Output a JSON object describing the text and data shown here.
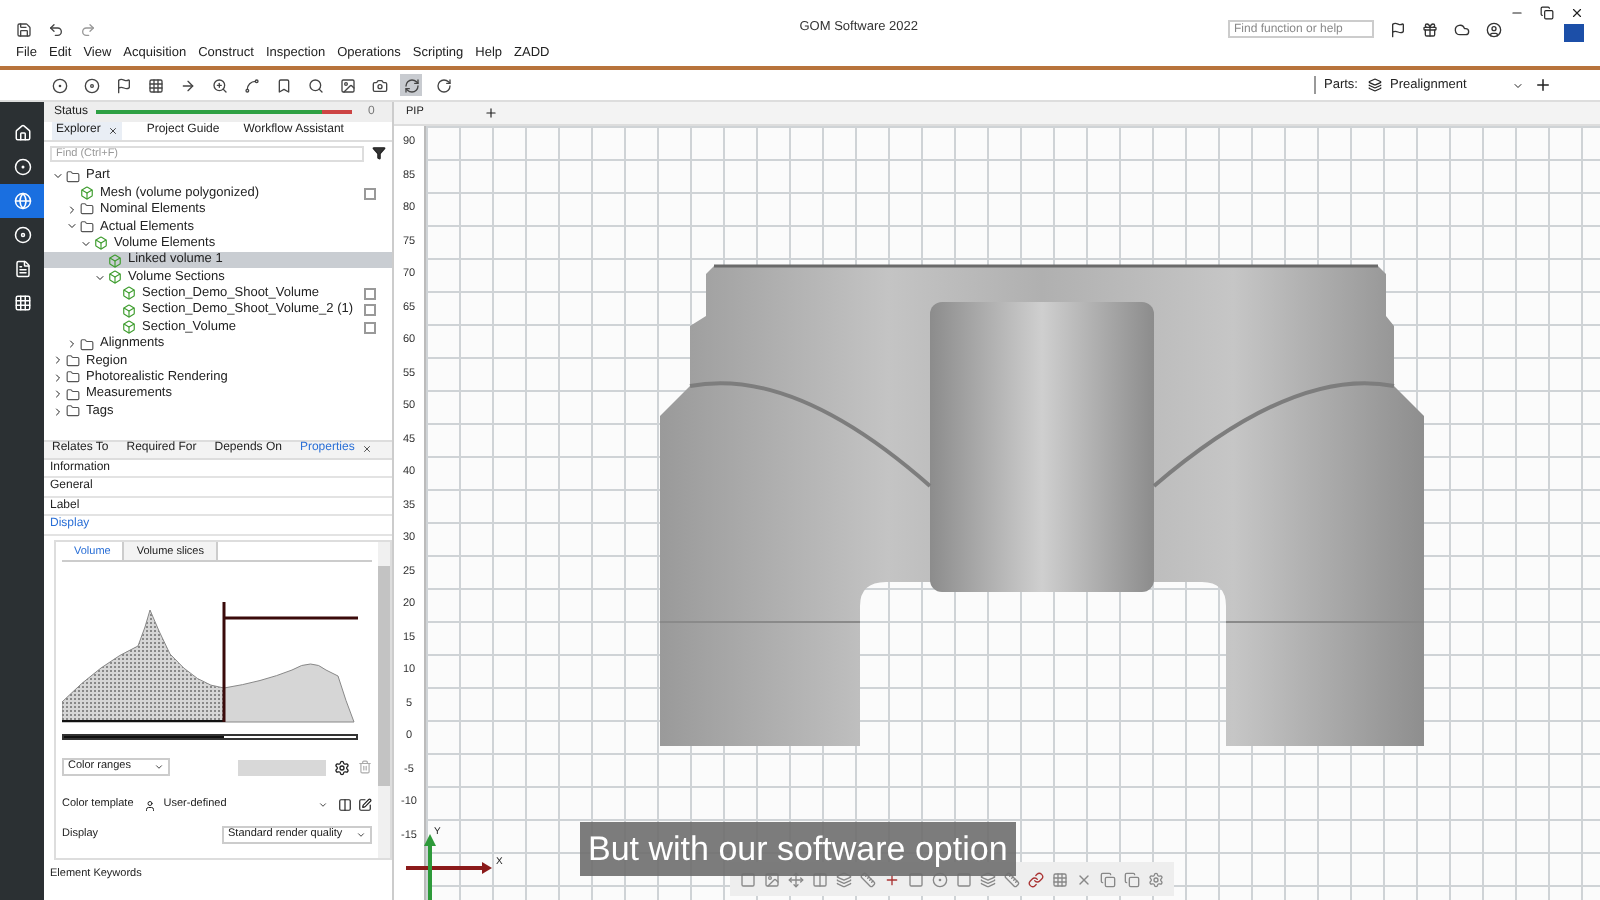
{
  "window": {
    "title": "GOM Software 2022",
    "search": {
      "placeholder": "Find function or help"
    }
  },
  "menu": [
    "File",
    "Edit",
    "View",
    "Acquisition",
    "Construct",
    "Inspection",
    "Operations",
    "Scripting",
    "Help",
    "ZADD"
  ],
  "toolbar": {
    "buttons": [
      {
        "selected": false
      },
      {
        "selected": false
      },
      {
        "selected": false
      },
      {
        "selected": false
      },
      {
        "selected": false
      },
      {
        "selected": false
      },
      {
        "selected": false
      },
      {
        "selected": false
      },
      {
        "selected": false
      },
      {
        "selected": false
      },
      {
        "selected": false
      },
      {
        "selected": true
      },
      {
        "selected": false
      }
    ],
    "parts_label": "Parts:",
    "part_value": "Prealignment"
  },
  "sidebar": {
    "items": [
      {
        "selected": false
      },
      {
        "selected": false
      },
      {
        "selected": true
      },
      {
        "selected": false
      },
      {
        "selected": false
      },
      {
        "selected": false
      }
    ]
  },
  "status": {
    "label": "Status",
    "level": 0.88,
    "count": "0"
  },
  "explorer": {
    "tabs": [
      {
        "label": "Explorer",
        "selected": true
      },
      {
        "label": "Project Guide",
        "selected": false
      },
      {
        "label": "Workflow Assistant",
        "selected": false
      }
    ],
    "search": {
      "placeholder": "Find (Ctrl+F)"
    },
    "tree": [
      {
        "label": "Part",
        "kind": "group",
        "expanded": true,
        "selected": false,
        "children": [
          {
            "label": "Mesh (volume polygonized)",
            "kind": "element",
            "selected": false,
            "checked": false
          },
          {
            "label": "Nominal Elements",
            "kind": "group",
            "expanded": false,
            "selected": false
          },
          {
            "label": "Actual Elements",
            "kind": "group",
            "expanded": true,
            "selected": false,
            "children": [
              {
                "label": "Volume Elements",
                "kind": "element",
                "expanded": true,
                "selected": false,
                "children": [
                  {
                    "label": "Linked volume 1",
                    "kind": "element",
                    "selected": true
                  },
                  {
                    "label": "Volume Sections",
                    "kind": "element",
                    "expanded": true,
                    "selected": false,
                    "children": [
                      {
                        "label": "Section_Demo_Shoot_Volume",
                        "kind": "element",
                        "selected": false,
                        "checked": false
                      },
                      {
                        "label": "Section_Demo_Shoot_Volume_2 (1)",
                        "kind": "element",
                        "selected": false,
                        "checked": false
                      },
                      {
                        "label": "Section_Volume",
                        "kind": "element",
                        "selected": false,
                        "checked": false
                      }
                    ]
                  }
                ]
              }
            ]
          },
          {
            "label": "Alignments",
            "kind": "group",
            "expanded": false,
            "selected": false
          }
        ]
      },
      {
        "label": "Region",
        "kind": "group",
        "expanded": false,
        "selected": false
      },
      {
        "label": "Photorealistic Rendering",
        "kind": "group",
        "expanded": false,
        "selected": false
      },
      {
        "label": "Measurements",
        "kind": "group",
        "expanded": false,
        "selected": false
      },
      {
        "label": "Tags",
        "kind": "group",
        "expanded": false,
        "selected": false
      }
    ]
  },
  "properties": {
    "tabs": [
      {
        "label": "Relates To",
        "selected": false
      },
      {
        "label": "Required For",
        "selected": false
      },
      {
        "label": "Depends On",
        "selected": false
      },
      {
        "label": "Properties",
        "selected": true
      }
    ],
    "sections": [
      {
        "label": "Information",
        "selected": false
      },
      {
        "label": "General",
        "selected": false
      },
      {
        "label": "Label",
        "selected": false
      },
      {
        "label": "Display",
        "selected": true
      }
    ],
    "subtabs": [
      {
        "label": "Volume",
        "selected": true
      },
      {
        "label": "Volume slices",
        "selected": false
      }
    ],
    "histogram": {
      "level": 0.55
    },
    "color_mode": "Color ranges",
    "color_template": {
      "label": "Color template",
      "value": "User-defined"
    },
    "display": {
      "label": "Display",
      "value": "Standard render quality"
    },
    "keywords": "Element Keywords"
  },
  "viewport": {
    "tab": "PIP",
    "ruler": [
      "90",
      "85",
      "80",
      "75",
      "70",
      "65",
      "60",
      "55",
      "50",
      "45",
      "40",
      "35",
      "30",
      "25",
      "20",
      "15",
      "10",
      "5",
      "0",
      "-5",
      "-10",
      "-15"
    ],
    "axes": [
      "Y",
      "X"
    ]
  },
  "caption": "But with our software option"
}
